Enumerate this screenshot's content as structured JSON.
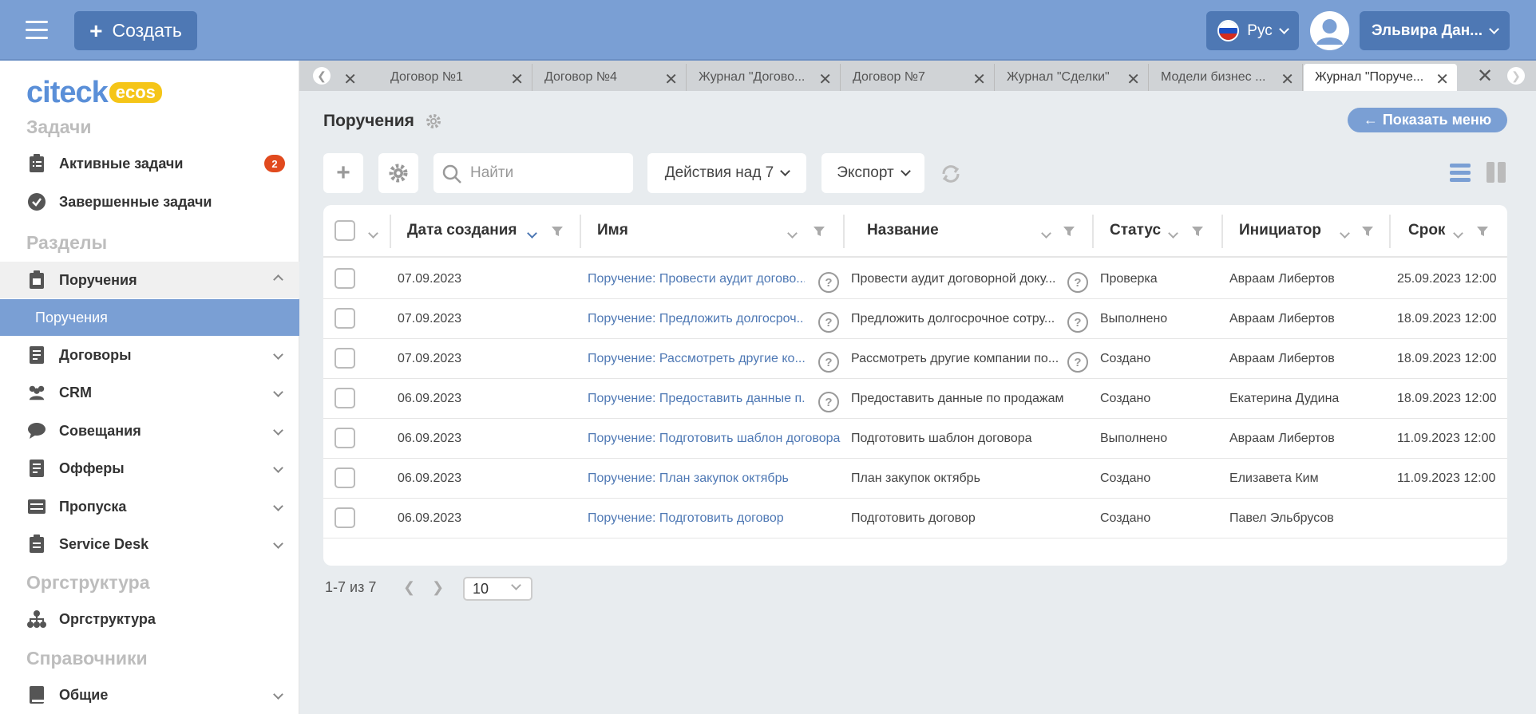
{
  "header": {
    "create_label": "Создать",
    "lang_label": "Рус",
    "user_name": "Эльвира Дан..."
  },
  "sidebar": {
    "logo_main": "citeck",
    "logo_badge": "ecos",
    "sections": {
      "tasks": "Задачи",
      "parts": "Разделы",
      "org": "Оргструктура",
      "refs": "Справочники"
    },
    "items": {
      "active_tasks": {
        "label": "Активные задачи",
        "badge": "2"
      },
      "done_tasks": {
        "label": "Завершенные задачи"
      },
      "assignments": {
        "label": "Поручения"
      },
      "assignments_sub": {
        "label": "Поручения"
      },
      "contracts": {
        "label": "Договоры"
      },
      "crm": {
        "label": "CRM"
      },
      "meetings": {
        "label": "Совещания"
      },
      "offers": {
        "label": "Офферы"
      },
      "passes": {
        "label": "Пропуска"
      },
      "servicedesk": {
        "label": "Service Desk"
      },
      "orgstruct": {
        "label": "Оргструктура"
      },
      "general": {
        "label": "Общие"
      }
    }
  },
  "tabs": [
    {
      "label": ""
    },
    {
      "label": "Договор №1"
    },
    {
      "label": "Договор №4"
    },
    {
      "label": "Журнал \"Догово..."
    },
    {
      "label": "Договор №7"
    },
    {
      "label": "Журнал \"Сделки\""
    },
    {
      "label": "Модели бизнес ..."
    },
    {
      "label": "Журнал \"Поруче..."
    }
  ],
  "page": {
    "title": "Поручения",
    "show_menu": "Показать меню",
    "search_placeholder": "Найти",
    "actions_label": "Действия над 7",
    "export_label": "Экспорт"
  },
  "table": {
    "columns": {
      "date": "Дата создания",
      "name": "Имя",
      "title": "Название",
      "status": "Статус",
      "initiator": "Инициатор",
      "due": "Срок"
    },
    "rows": [
      {
        "date": "07.09.2023",
        "name": "Поручение: Провести аудит догово...",
        "name_help": true,
        "title": "Провести аудит договорной доку...",
        "title_help": true,
        "status": "Проверка",
        "initiator": "Авраам Либертов",
        "due": "25.09.2023 12:00"
      },
      {
        "date": "07.09.2023",
        "name": "Поручение: Предложить долгосроч...",
        "name_help": true,
        "title": "Предложить долгосрочное сотру...",
        "title_help": true,
        "status": "Выполнено",
        "initiator": "Авраам Либертов",
        "due": "18.09.2023 12:00"
      },
      {
        "date": "07.09.2023",
        "name": "Поручение: Рассмотреть другие ко...",
        "name_help": true,
        "title": "Рассмотреть другие компании по...",
        "title_help": true,
        "status": "Создано",
        "initiator": "Авраам Либертов",
        "due": "18.09.2023 12:00"
      },
      {
        "date": "06.09.2023",
        "name": "Поручение: Предоставить данные п...",
        "name_help": true,
        "title": "Предоставить данные по продажам",
        "title_help": false,
        "status": "Создано",
        "initiator": "Екатерина Дудина",
        "due": "18.09.2023 12:00"
      },
      {
        "date": "06.09.2023",
        "name": "Поручение: Подготовить шаблон договора",
        "name_help": false,
        "title": "Подготовить шаблон договора",
        "title_help": false,
        "status": "Выполнено",
        "initiator": "Авраам Либертов",
        "due": "11.09.2023 12:00"
      },
      {
        "date": "06.09.2023",
        "name": "Поручение: План закупок октябрь",
        "name_help": false,
        "title": "План закупок октябрь",
        "title_help": false,
        "status": "Создано",
        "initiator": "Елизавета Ким",
        "due": "11.09.2023 12:00"
      },
      {
        "date": "06.09.2023",
        "name": "Поручение: Подготовить договор",
        "name_help": false,
        "title": "Подготовить договор",
        "title_help": false,
        "status": "Создано",
        "initiator": "Павел Эльбрусов",
        "due": ""
      }
    ]
  },
  "pagination": {
    "range": "1-7 из 7",
    "page_size": "10"
  },
  "colors": {
    "topbar": "#7a9fd4",
    "button": "#4e78b4",
    "badge": "#e14a1e",
    "logo_badge": "#f5c518"
  }
}
